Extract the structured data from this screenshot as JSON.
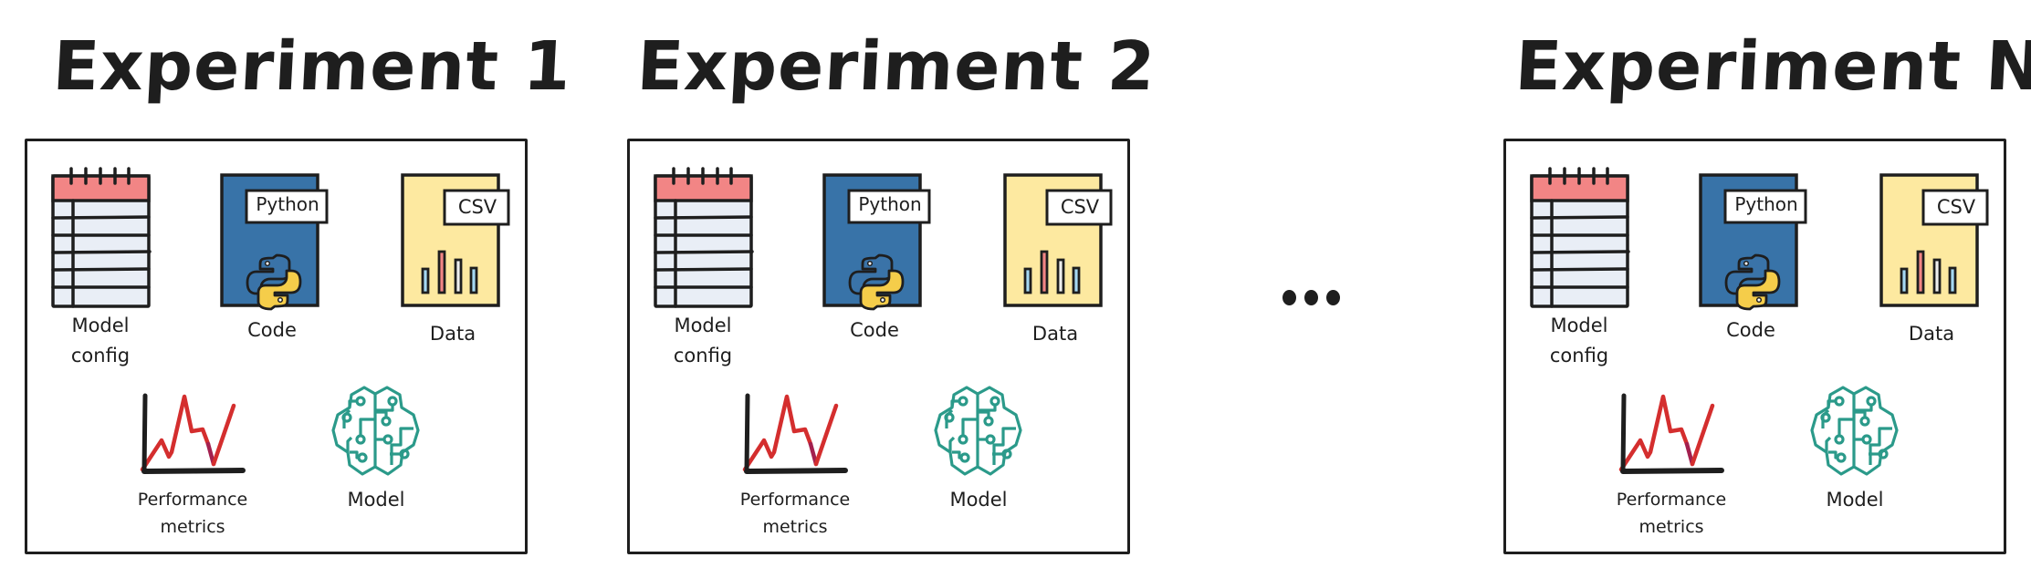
{
  "diagram": {
    "experiments": [
      {
        "title": "Experiment 1",
        "artifacts": {
          "model_config": {
            "label_line1": "Model",
            "label_line2": "config"
          },
          "code": {
            "label": "Code",
            "badge": "Python"
          },
          "data": {
            "label": "Data",
            "badge": "CSV"
          },
          "performance": {
            "label_line1": "Performance",
            "label_line2": "metrics"
          },
          "model": {
            "label": "Model"
          }
        }
      },
      {
        "title": "Experiment 2",
        "artifacts": {
          "model_config": {
            "label_line1": "Model",
            "label_line2": "config"
          },
          "code": {
            "label": "Code",
            "badge": "Python"
          },
          "data": {
            "label": "Data",
            "badge": "CSV"
          },
          "performance": {
            "label_line1": "Performance",
            "label_line2": "metrics"
          },
          "model": {
            "label": "Model"
          }
        }
      },
      {
        "title": "Experiment N",
        "artifacts": {
          "model_config": {
            "label_line1": "Model",
            "label_line2": "config"
          },
          "code": {
            "label": "Code",
            "badge": "Python"
          },
          "data": {
            "label": "Data",
            "badge": "CSV"
          },
          "performance": {
            "label_line1": "Performance",
            "label_line2": "metrics"
          },
          "model": {
            "label": "Model"
          }
        }
      }
    ],
    "ellipsis": "...",
    "icons": {
      "model_config": "notepad-icon",
      "code": "python-file-icon",
      "data": "csv-file-icon",
      "performance": "line-chart-icon",
      "model": "brain-circuit-icon"
    },
    "colors": {
      "ink": "#1e1e1e",
      "notepad_header": "#f28585",
      "notepad_body": "#e9eef6",
      "python_doc": "#3873a8",
      "python_blue": "#3a73a8",
      "python_yellow": "#f5cd4a",
      "csv_doc": "#fde9a0",
      "bar_blue": "#a5d8f3",
      "bar_red": "#f28585",
      "bar_white": "#eeeeee",
      "chart_line": "#d42e2e",
      "chart_line_dark": "#a3204f",
      "brain": "#2b9a8a"
    }
  }
}
